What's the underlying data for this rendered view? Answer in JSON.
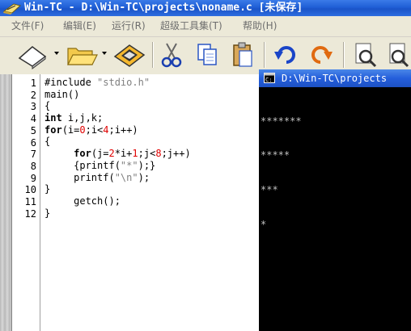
{
  "window": {
    "title": "Win-TC - D:\\Win-TC\\projects\\noname.c [未保存]"
  },
  "menu": {
    "items": [
      {
        "label": "文件(F)"
      },
      {
        "label": "编辑(E)"
      },
      {
        "label": "运行(R)"
      },
      {
        "label": "超级工具集(T)"
      },
      {
        "label": "帮助(H)"
      }
    ]
  },
  "toolbar": {
    "icons": [
      "new-file-icon",
      "open-folder-icon",
      "save-icon",
      "cut-icon",
      "copy-icon",
      "paste-icon",
      "undo-icon",
      "redo-icon",
      "find-icon",
      "replace-icon"
    ]
  },
  "editor": {
    "line_numbers": [
      "1",
      "2",
      "3",
      "4",
      "5",
      "6",
      "7",
      "8",
      "9",
      "10",
      "11",
      "12"
    ]
  },
  "console": {
    "title": "D:\\Win-TC\\projects",
    "output": [
      "*******",
      "*****",
      "***",
      "*"
    ]
  }
}
